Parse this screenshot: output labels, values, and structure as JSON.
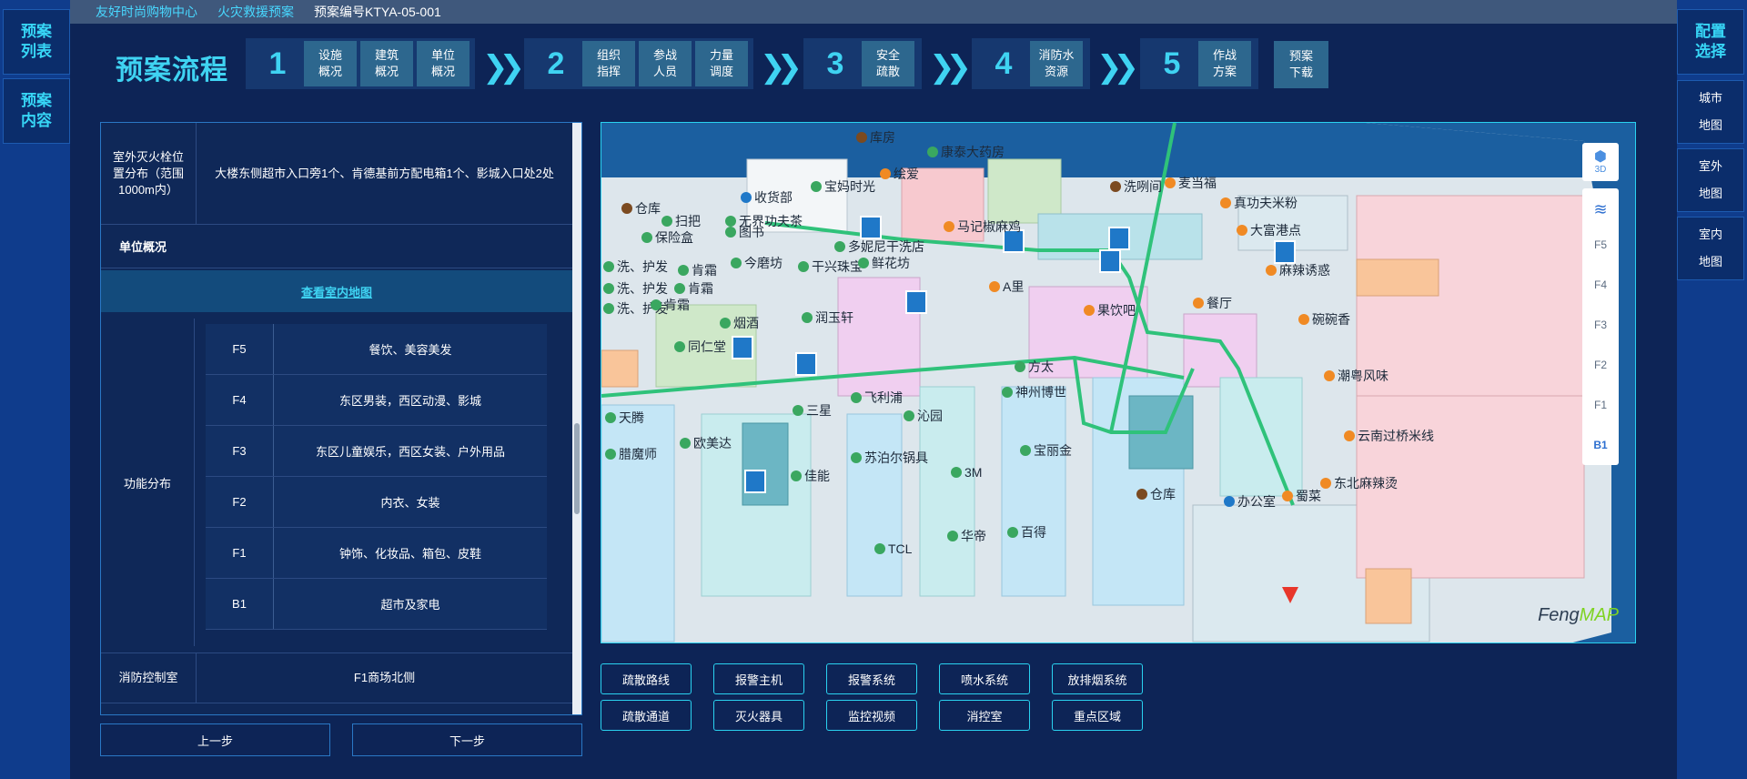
{
  "left_sidebar": {
    "items": [
      {
        "label": "预案\n列表"
      },
      {
        "label": "预案\n内容"
      }
    ]
  },
  "right_sidebar": {
    "config": "配置\n选择",
    "items": [
      {
        "label": "城市\n地图"
      },
      {
        "label": "室外\n地图"
      },
      {
        "label": "室内\n地图"
      }
    ]
  },
  "topbar": {
    "crumb1": "友好时尚购物中心",
    "crumb2": "火灾救援预案",
    "code": "预案编号KTYA-05-001"
  },
  "flow": {
    "title": "预案流程",
    "steps": [
      {
        "num": "1",
        "buttons": [
          "设施\n概况",
          "建筑\n概况",
          "单位\n概况"
        ]
      },
      {
        "num": "2",
        "buttons": [
          "组织\n指挥",
          "参战\n人员",
          "力量\n调度"
        ]
      },
      {
        "num": "3",
        "buttons": [
          "安全\n疏散"
        ]
      },
      {
        "num": "4",
        "buttons": [
          "消防水\n资源"
        ]
      },
      {
        "num": "5",
        "buttons": [
          "作战\n方案"
        ]
      }
    ],
    "download": "预案\n下载"
  },
  "info": {
    "hydrant_label": "室外灭火栓位置分布（范围1000m内）",
    "hydrant_value": "大楼东侧超市入口旁1个、肯德基前方配电箱1个、影城入口处2处",
    "unit_overview": "单位概况",
    "indoor_link": "查看室内地图",
    "func_label": "功能分布",
    "floors": [
      {
        "floor": "F5",
        "desc": "餐饮、美容美发"
      },
      {
        "floor": "F4",
        "desc": "东区男装，西区动漫、影城"
      },
      {
        "floor": "F3",
        "desc": "东区儿童娱乐，西区女装、户外用品"
      },
      {
        "floor": "F2",
        "desc": "内衣、女装"
      },
      {
        "floor": "F1",
        "desc": "钟饰、化妆品、箱包、皮鞋"
      },
      {
        "floor": "B1",
        "desc": "超市及家电"
      }
    ],
    "control_label": "消防控制室",
    "control_value": "F1商场北侧"
  },
  "nav": {
    "prev": "上一步",
    "next": "下一步"
  },
  "map": {
    "tool_3d": "3D",
    "floors": [
      "F5",
      "F4",
      "F3",
      "F2",
      "F1",
      "B1"
    ],
    "active_floor": "B1",
    "logo_a": "Feng",
    "logo_b": "MAP",
    "labels": {
      "l1": "库房",
      "l2": "康泰大药房",
      "l3": "宝妈时光",
      "l4": "绘爱",
      "l5": "洗咧间",
      "l6": "麦当福",
      "l7": "仓库",
      "l8": "收货部",
      "l9": "扫把",
      "l10": "无界功夫茶",
      "l11": "马记椒麻鸡",
      "l12": "真功夫米粉",
      "l13": "保险盒",
      "l14": "图书",
      "l15": "多妮尼干洗店",
      "l16": "大富港点",
      "l17": "洗、护发",
      "l18": "肯霜",
      "l19": "今磨坊",
      "l20": "干兴珠宝",
      "l21": "鲜花坊",
      "l22": "A里",
      "l23": "麻辣诱惑",
      "l24": "洗、护发",
      "l25": "肯霜",
      "l26": "餐厅",
      "l27": "洗、护发",
      "l28": "肯霜",
      "l29": "果饮吧",
      "l30": "润玉轩",
      "l31": "烟酒",
      "l32": "碗碗香",
      "l33": "同仁堂",
      "l34": "方太",
      "l35": "潮粤风味",
      "l36": "飞利浦",
      "l37": "神州博世",
      "l38": "天腾",
      "l39": "三星",
      "l40": "沁园",
      "l41": "欧美达",
      "l42": "云南过桥米线",
      "l43": "腊魔师",
      "l44": "苏泊尔锅具",
      "l45": "宝丽金",
      "l46": "佳能",
      "l47": "3M",
      "l48": "东北麻辣烫",
      "l49": "仓库",
      "l50": "办公室",
      "l51": "蜀菜",
      "l52": "华帝",
      "l53": "百得",
      "l54": "TCL"
    }
  },
  "layer_buttons": {
    "row1": [
      "疏散路线",
      "报警主机",
      "报警系统",
      "喷水系统",
      "放排烟系统"
    ],
    "row2": [
      "疏散通道",
      "灭火器具",
      "监控视频",
      "消控室",
      "重点区域"
    ]
  },
  "colors": {
    "accent": "#3fd3f2",
    "panel": "#0d2456",
    "side": "#0f3c8c",
    "route": "#2fc27a"
  }
}
